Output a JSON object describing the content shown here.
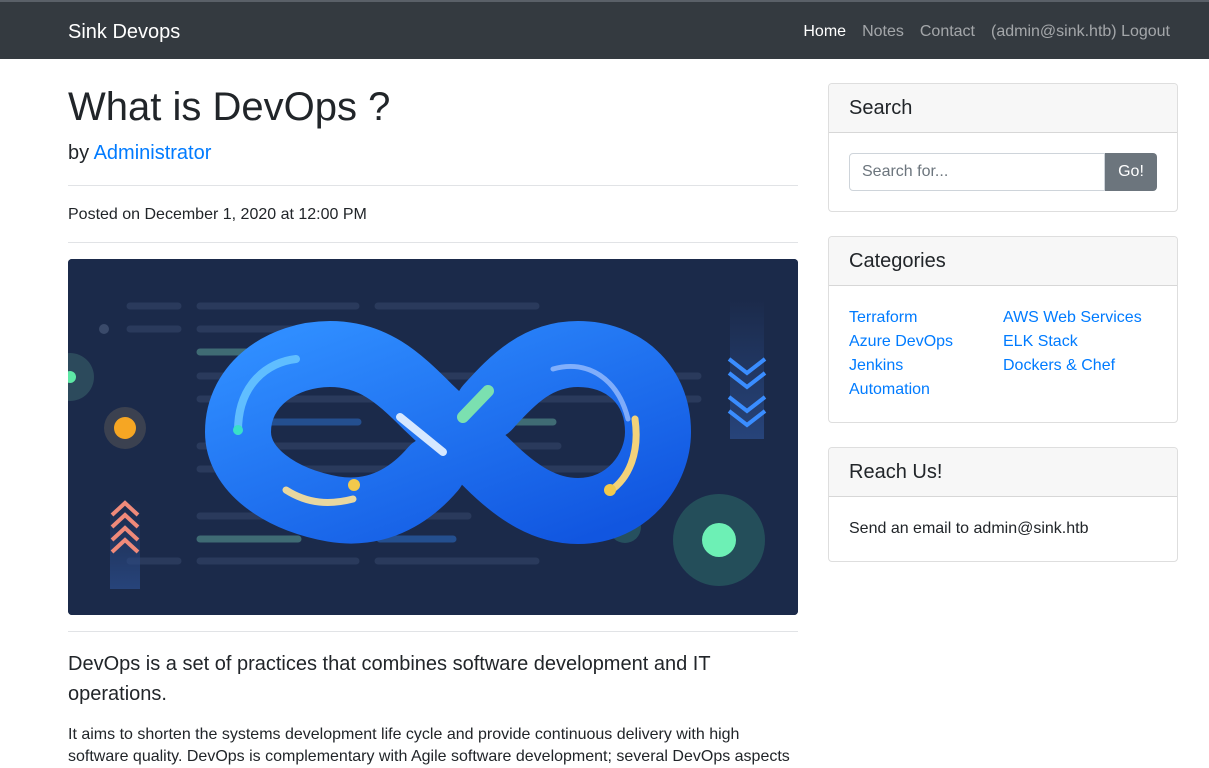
{
  "navbar": {
    "brand": "Sink Devops",
    "links": [
      "Home",
      "Notes",
      "Contact",
      "(admin@sink.htb) Logout"
    ]
  },
  "post": {
    "title": "What is DevOps ?",
    "by_prefix": "by",
    "author": "Administrator",
    "posted": "Posted on December 1, 2020 at 12:00 PM",
    "lead": "DevOps is a set of practices that combines software development and IT operations.",
    "body": "It aims to shorten the systems development life cycle and provide continuous delivery with high software quality. DevOps is complementary with Agile software development; several DevOps aspects"
  },
  "sidebar": {
    "search": {
      "title": "Search",
      "placeholder": "Search for...",
      "button": "Go!"
    },
    "categories": {
      "title": "Categories",
      "left": [
        "Terraform",
        "Azure DevOps",
        "Jenkins",
        "Automation"
      ],
      "right": [
        "AWS Web Services",
        "ELK Stack",
        "Dockers & Chef"
      ]
    },
    "reach": {
      "title": "Reach Us!",
      "text": "Send an email to admin@sink.htb"
    }
  },
  "colors": {
    "navbar": "#343a40",
    "link": "#007bff",
    "button": "#6c757d",
    "accent": "#1a6cf5"
  }
}
